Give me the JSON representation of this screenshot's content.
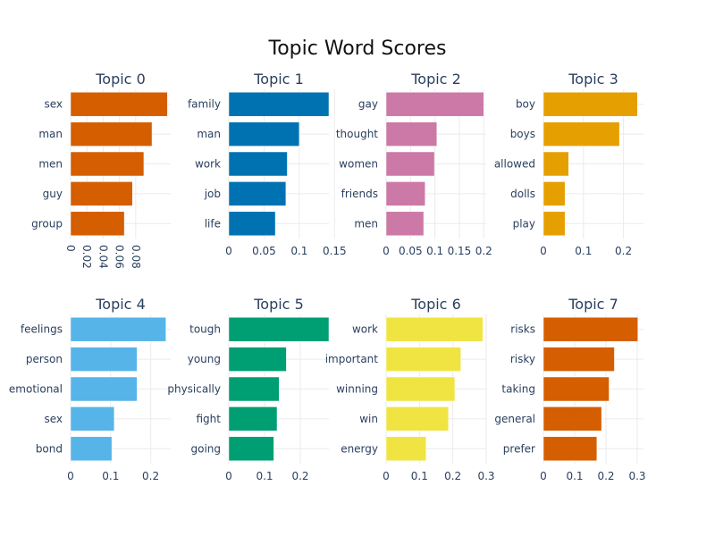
{
  "title": "Topic Word Scores",
  "chart_data": [
    {
      "type": "bar",
      "orientation": "horizontal",
      "title": "Topic 0",
      "color": "#D55E00",
      "categories": [
        "sex",
        "man",
        "men",
        "guy",
        "group"
      ],
      "values": [
        0.119,
        0.1,
        0.09,
        0.076,
        0.066
      ],
      "xlim": [
        0,
        0.123
      ],
      "xticks": [
        0,
        0.02,
        0.04,
        0.06,
        0.08
      ],
      "xtick_labels": [
        "0",
        "0.02",
        "0.04",
        "0.06",
        "0.08"
      ],
      "xtick_rotation": 90,
      "grid": true
    },
    {
      "type": "bar",
      "orientation": "horizontal",
      "title": "Topic 1",
      "color": "#0072B2",
      "categories": [
        "family",
        "man",
        "work",
        "job",
        "life"
      ],
      "values": [
        0.142,
        0.1,
        0.083,
        0.081,
        0.066
      ],
      "xlim": [
        0,
        0.142
      ],
      "xticks": [
        0,
        0.05,
        0.1,
        0.15
      ],
      "xtick_labels": [
        "0",
        "0.05",
        "0.1",
        "0.15"
      ],
      "xtick_rotation": 0,
      "grid": true
    },
    {
      "type": "bar",
      "orientation": "horizontal",
      "title": "Topic 2",
      "color": "#CC79A7",
      "categories": [
        "gay",
        "thought",
        "women",
        "friends",
        "men"
      ],
      "values": [
        0.2,
        0.104,
        0.099,
        0.08,
        0.077
      ],
      "xlim": [
        0,
        0.205
      ],
      "xticks": [
        0,
        0.05,
        0.1,
        0.15,
        0.2
      ],
      "xtick_labels": [
        "0",
        "0.05",
        "0.1",
        "0.15",
        "0.2"
      ],
      "xtick_rotation": 0,
      "grid": true
    },
    {
      "type": "bar",
      "orientation": "horizontal",
      "title": "Topic 3",
      "color": "#E69F00",
      "categories": [
        "boy",
        "boys",
        "allowed",
        "dolls",
        "play"
      ],
      "values": [
        0.235,
        0.19,
        0.063,
        0.054,
        0.054
      ],
      "xlim": [
        0,
        0.25
      ],
      "xticks": [
        0,
        0.1,
        0.2
      ],
      "xtick_labels": [
        "0",
        "0.1",
        "0.2"
      ],
      "xtick_rotation": 0,
      "grid": true
    },
    {
      "type": "bar",
      "orientation": "horizontal",
      "title": "Topic 4",
      "color": "#56B4E9",
      "categories": [
        "feelings",
        "person",
        "emotional",
        "sex",
        "bond"
      ],
      "values": [
        0.238,
        0.166,
        0.166,
        0.109,
        0.103
      ],
      "xlim": [
        0,
        0.25
      ],
      "xticks": [
        0,
        0.1,
        0.2
      ],
      "xtick_labels": [
        "0",
        "0.1",
        "0.2"
      ],
      "xtick_rotation": 0,
      "grid": true
    },
    {
      "type": "bar",
      "orientation": "horizontal",
      "title": "Topic 5",
      "color": "#009E73",
      "categories": [
        "tough",
        "young",
        "physically",
        "fight",
        "going"
      ],
      "values": [
        0.28,
        0.161,
        0.141,
        0.135,
        0.126
      ],
      "xlim": [
        0,
        0.28
      ],
      "xticks": [
        0,
        0.1,
        0.2
      ],
      "xtick_labels": [
        "0",
        "0.1",
        "0.2"
      ],
      "xtick_rotation": 0,
      "grid": true
    },
    {
      "type": "bar",
      "orientation": "horizontal",
      "title": "Topic 6",
      "color": "#F0E442",
      "categories": [
        "work",
        "important",
        "winning",
        "win",
        "energy"
      ],
      "values": [
        0.29,
        0.224,
        0.206,
        0.187,
        0.12
      ],
      "xlim": [
        0,
        0.3
      ],
      "xticks": [
        0,
        0.1,
        0.2,
        0.3
      ],
      "xtick_labels": [
        "0",
        "0.1",
        "0.2",
        "0.3"
      ],
      "xtick_rotation": 0,
      "grid": true
    },
    {
      "type": "bar",
      "orientation": "horizontal",
      "title": "Topic 7",
      "color": "#D55E00",
      "categories": [
        "risks",
        "risky",
        "taking",
        "general",
        "prefer"
      ],
      "values": [
        0.302,
        0.227,
        0.21,
        0.186,
        0.171
      ],
      "xlim": [
        0,
        0.32
      ],
      "xticks": [
        0,
        0.1,
        0.2,
        0.3
      ],
      "xtick_labels": [
        "0",
        "0.1",
        "0.2",
        "0.3"
      ],
      "xtick_rotation": 0,
      "grid": true
    }
  ]
}
